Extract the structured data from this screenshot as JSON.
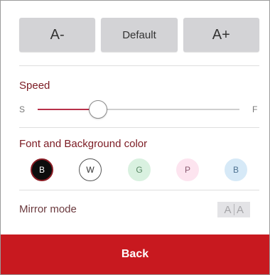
{
  "font_size": {
    "decrease_label": "A-",
    "default_label": "Default",
    "increase_label": "A+"
  },
  "speed": {
    "label": "Speed",
    "min_label": "S",
    "max_label": "F",
    "value_fraction": 0.3
  },
  "color": {
    "label": "Font and Background color",
    "options": [
      {
        "label": "B",
        "background": "#0d0d0d",
        "text": "#ffffff",
        "border": "#8a1c24",
        "selected": true
      },
      {
        "label": "W",
        "background": "#ffffff",
        "text": "#333333",
        "border": "#555555",
        "selected": false
      },
      {
        "label": "G",
        "background": "#d9f1e0",
        "text": "#5a8a66",
        "border": "#d9f1e0",
        "selected": false
      },
      {
        "label": "P",
        "background": "#fde4ef",
        "text": "#8a5a70",
        "border": "#fde4ef",
        "selected": false
      },
      {
        "label": "B",
        "background": "#d6e9f7",
        "text": "#4f7392",
        "border": "#d6e9f7",
        "selected": false
      }
    ]
  },
  "mirror": {
    "label": "Mirror mode",
    "glyph": "A"
  },
  "back_label": "Back",
  "colors": {
    "accent": "#c8191f",
    "section_label": "#7b1a22",
    "slider_fill": "#b8304a"
  }
}
